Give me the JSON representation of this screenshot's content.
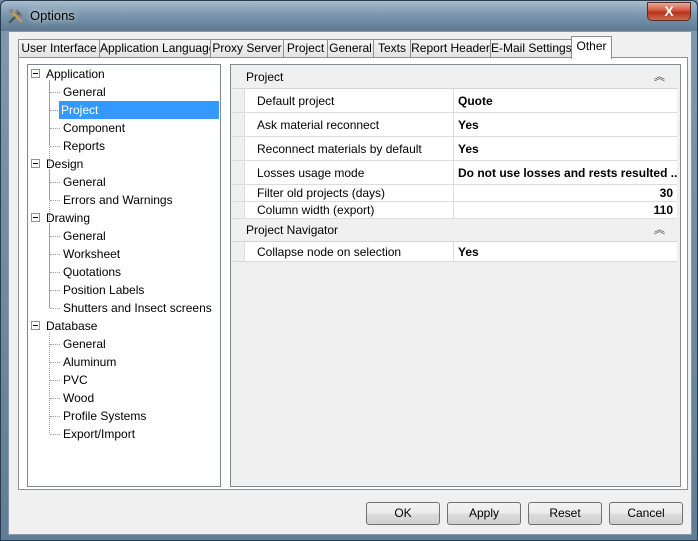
{
  "window": {
    "title": "Options",
    "close_label": "X"
  },
  "tabs": [
    {
      "label": "User Interface"
    },
    {
      "label": "Application Language"
    },
    {
      "label": "Proxy Server"
    },
    {
      "label": "Project"
    },
    {
      "label": "General"
    },
    {
      "label": "Texts"
    },
    {
      "label": "Report Header"
    },
    {
      "label": "E-Mail Settings"
    },
    {
      "label": "Other"
    }
  ],
  "active_tab": "Other",
  "tree": {
    "application": {
      "label": "Application",
      "children": [
        "General",
        "Project",
        "Component",
        "Reports"
      ]
    },
    "design": {
      "label": "Design",
      "children": [
        "General",
        "Errors and Warnings"
      ]
    },
    "drawing": {
      "label": "Drawing",
      "children": [
        "General",
        "Worksheet",
        "Quotations",
        "Position Labels",
        "Shutters and Insect screens"
      ]
    },
    "database": {
      "label": "Database",
      "children": [
        "General",
        "Aluminum",
        "PVC",
        "Wood",
        "Profile Systems",
        "Export/Import"
      ]
    },
    "selected": "Project"
  },
  "grid": {
    "project": {
      "header": "Project",
      "rows": [
        {
          "name": "Default project",
          "value": "Quote"
        },
        {
          "name": "Ask material reconnect",
          "value": "Yes"
        },
        {
          "name": "Reconnect materials by default",
          "value": "Yes"
        },
        {
          "name": "Losses usage mode",
          "value": "Do not use losses and rests resulted ..."
        },
        {
          "name": "Filter old projects (days)",
          "value": "30"
        },
        {
          "name": "Column width (export)",
          "value": "110"
        }
      ]
    },
    "navigator": {
      "header": "Project Navigator",
      "rows": [
        {
          "name": "Collapse node on selection",
          "value": "Yes"
        }
      ]
    },
    "collapse_glyph": "︽"
  },
  "buttons": {
    "ok": "OK",
    "apply": "Apply",
    "reset": "Reset",
    "cancel": "Cancel"
  }
}
